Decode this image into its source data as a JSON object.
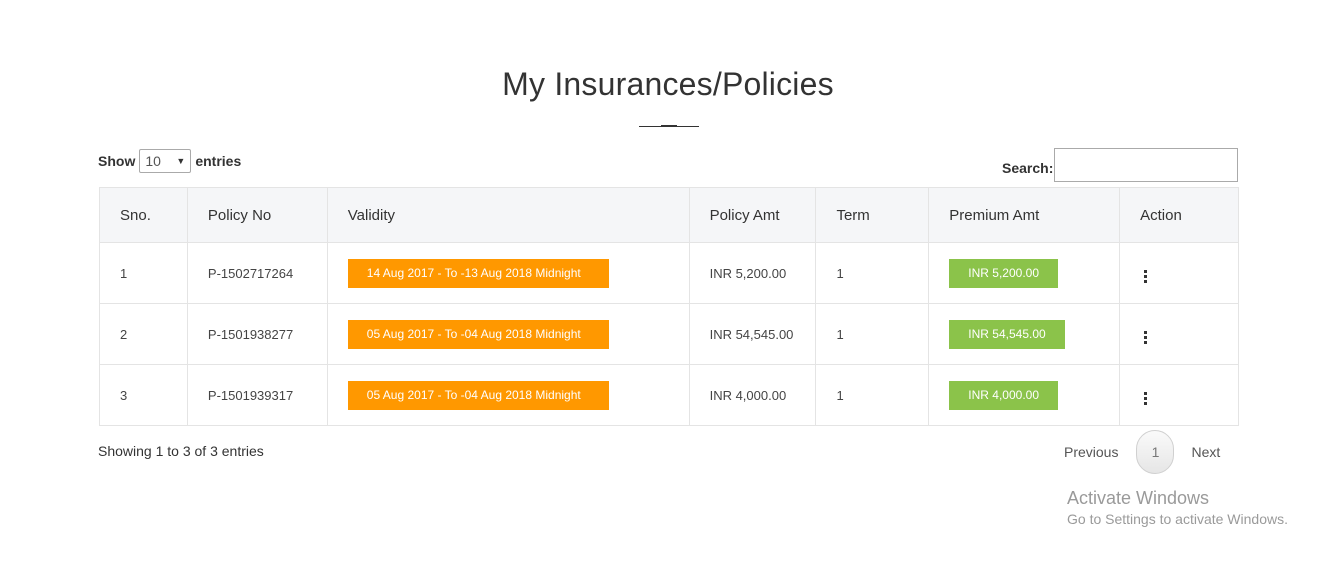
{
  "page": {
    "title": "My Insurances/Policies"
  },
  "length_menu": {
    "show_label": "Show",
    "selected": "10",
    "entries_label": "entries"
  },
  "search": {
    "label": "Search:",
    "value": ""
  },
  "table": {
    "headers": [
      "Sno.",
      "Policy No",
      "Validity",
      "Policy Amt",
      "Term",
      "Premium Amt",
      "Action"
    ],
    "rows": [
      {
        "sno": "1",
        "policy_no": "P-1502717264",
        "validity": "14 Aug 2017 - To -13 Aug 2018 Midnight",
        "policy_amt": "INR 5,200.00",
        "term": "1",
        "premium_amt": "INR 5,200.00"
      },
      {
        "sno": "2",
        "policy_no": "P-1501938277",
        "validity": "05 Aug 2017 - To -04 Aug 2018 Midnight",
        "policy_amt": "INR 54,545.00",
        "term": "1",
        "premium_amt": "INR 54,545.00"
      },
      {
        "sno": "3",
        "policy_no": "P-1501939317",
        "validity": "05 Aug 2017 - To -04 Aug 2018 Midnight",
        "policy_amt": "INR 4,000.00",
        "term": "1",
        "premium_amt": "INR 4,000.00"
      }
    ]
  },
  "info": "Showing 1 to 3 of 3 entries",
  "pagination": {
    "previous": "Previous",
    "current": "1",
    "next": "Next"
  },
  "watermark": {
    "title": "Activate Windows",
    "subtitle": "Go to Settings to activate Windows."
  },
  "colors": {
    "validity_badge": "#ff9800",
    "premium_badge": "#8bc34a",
    "header_bg": "#f5f6f8"
  },
  "icons": {
    "action": "kebab-menu-icon"
  }
}
